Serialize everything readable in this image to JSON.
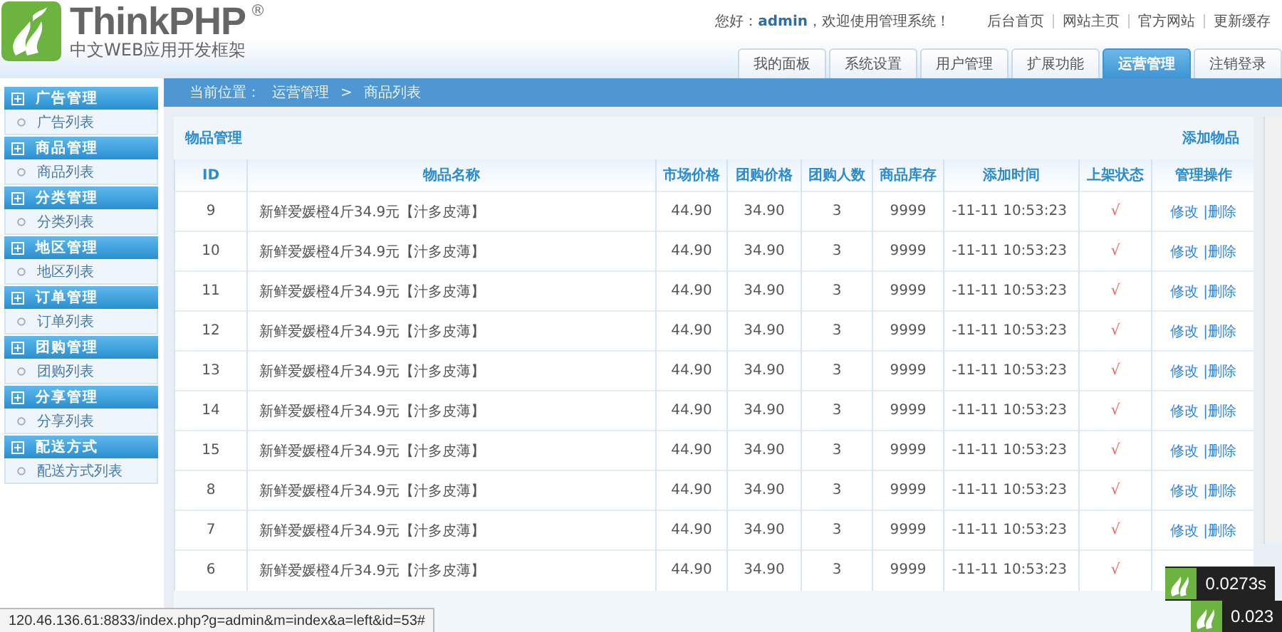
{
  "logo": {
    "name": "ThinkPHP",
    "mark": "®",
    "tagline": "中文WEB应用开发框架"
  },
  "header": {
    "welcome": "您好：**admin**，欢迎使用管理系统！",
    "links": [
      "后台首页",
      "网站主页",
      "官方网站",
      "更新缓存"
    ]
  },
  "tabs": [
    {
      "label": "我的面板",
      "selected": false
    },
    {
      "label": "系统设置",
      "selected": false
    },
    {
      "label": "用户管理",
      "selected": false
    },
    {
      "label": "扩展功能",
      "selected": false
    },
    {
      "label": "运营管理",
      "selected": true
    },
    {
      "label": "注销登录",
      "selected": false
    }
  ],
  "sidebar": [
    {
      "title": "广告管理",
      "items": [
        "广告列表"
      ]
    },
    {
      "title": "商品管理",
      "items": [
        "商品列表"
      ]
    },
    {
      "title": "分类管理",
      "items": [
        "分类列表"
      ]
    },
    {
      "title": "地区管理",
      "items": [
        "地区列表"
      ]
    },
    {
      "title": "订单管理",
      "items": [
        "订单列表"
      ]
    },
    {
      "title": "团购管理",
      "items": [
        "团购列表"
      ]
    },
    {
      "title": "分享管理",
      "items": [
        "分享列表"
      ]
    },
    {
      "title": "配送方式",
      "items": [
        "配送方式列表"
      ]
    }
  ],
  "breadcrumb": [
    "当前位置：",
    "运营管理",
    ">",
    "商品列表"
  ],
  "panel": {
    "title": "物品管理",
    "action": "添加物品"
  },
  "table": {
    "columns": [
      "ID",
      "物品名称",
      "市场价格",
      "团购价格",
      "团购人数",
      "商品库存",
      "添加时间",
      "上架状态",
      "管理操作"
    ],
    "rows": [
      {
        "id": "9",
        "name": "新鲜爱媛橙4斤34.9元【汁多皮薄】",
        "market_price": "44.90",
        "group_price": "34.90",
        "buyers": "3",
        "stock": "9999",
        "time": "-11-11 10:53:23",
        "status": "√",
        "edit": "修改",
        "delete": "|删除"
      },
      {
        "id": "10",
        "name": "新鲜爱媛橙4斤34.9元【汁多皮薄】",
        "market_price": "44.90",
        "group_price": "34.90",
        "buyers": "3",
        "stock": "9999",
        "time": "-11-11 10:53:23",
        "status": "√",
        "edit": "修改",
        "delete": "|删除"
      },
      {
        "id": "11",
        "name": "新鲜爱媛橙4斤34.9元【汁多皮薄】",
        "market_price": "44.90",
        "group_price": "34.90",
        "buyers": "3",
        "stock": "9999",
        "time": "-11-11 10:53:23",
        "status": "√",
        "edit": "修改",
        "delete": "|删除"
      },
      {
        "id": "12",
        "name": "新鲜爱媛橙4斤34.9元【汁多皮薄】",
        "market_price": "44.90",
        "group_price": "34.90",
        "buyers": "3",
        "stock": "9999",
        "time": "-11-11 10:53:23",
        "status": "√",
        "edit": "修改",
        "delete": "|删除"
      },
      {
        "id": "13",
        "name": "新鲜爱媛橙4斤34.9元【汁多皮薄】",
        "market_price": "44.90",
        "group_price": "34.90",
        "buyers": "3",
        "stock": "9999",
        "time": "-11-11 10:53:23",
        "status": "√",
        "edit": "修改",
        "delete": "|删除"
      },
      {
        "id": "14",
        "name": "新鲜爱媛橙4斤34.9元【汁多皮薄】",
        "market_price": "44.90",
        "group_price": "34.90",
        "buyers": "3",
        "stock": "9999",
        "time": "-11-11 10:53:23",
        "status": "√",
        "edit": "修改",
        "delete": "|删除"
      },
      {
        "id": "15",
        "name": "新鲜爱媛橙4斤34.9元【汁多皮薄】",
        "market_price": "44.90",
        "group_price": "34.90",
        "buyers": "3",
        "stock": "9999",
        "time": "-11-11 10:53:23",
        "status": "√",
        "edit": "修改",
        "delete": "|删除"
      },
      {
        "id": "8",
        "name": "新鲜爱媛橙4斤34.9元【汁多皮薄】",
        "market_price": "44.90",
        "group_price": "34.90",
        "buyers": "3",
        "stock": "9999",
        "time": "-11-11 10:53:23",
        "status": "√",
        "edit": "修改",
        "delete": "|删除"
      },
      {
        "id": "7",
        "name": "新鲜爱媛橙4斤34.9元【汁多皮薄】",
        "market_price": "44.90",
        "group_price": "34.90",
        "buyers": "3",
        "stock": "9999",
        "time": "-11-11 10:53:23",
        "status": "√",
        "edit": "修改",
        "delete": "|删除"
      },
      {
        "id": "6",
        "name": "新鲜爱媛橙4斤34.9元【汁多皮薄】",
        "market_price": "44.90",
        "group_price": "34.90",
        "buyers": "3",
        "stock": "9999",
        "time": "-11-11 10:53:23",
        "status": "√"
      }
    ]
  },
  "status_bar": {
    "url": "120.46.136.61:8833/index.php?g=admin&m=index&a=left&id=53#"
  },
  "trace": [
    "0.0273s",
    "0.023"
  ]
}
